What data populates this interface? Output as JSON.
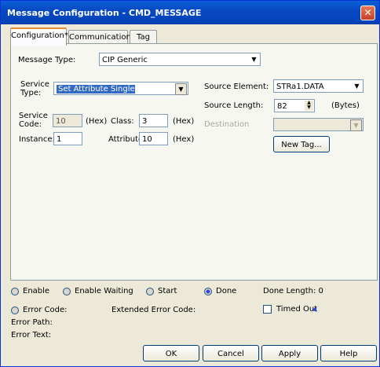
{
  "window": {
    "title": "Message Configuration - CMD_MESSAGE",
    "close_glyph": "✕"
  },
  "tabs": [
    {
      "label": "Configuration*"
    },
    {
      "label": "Communication"
    },
    {
      "label": "Tag"
    }
  ],
  "config": {
    "message_type_label": "Message Type:",
    "message_type_value": "CIP Generic",
    "service_type_label_1": "Service",
    "service_type_label_2": "Type:",
    "service_type_value": "Set Attribute Single",
    "service_code_label_1": "Service",
    "service_code_label_2": "Code:",
    "service_code_value": "10",
    "hex_label": "(Hex)",
    "class_label": "Class:",
    "class_value": "3",
    "instance_label": "Instance:",
    "instance_value": "1",
    "attribute_label": "Attribute:",
    "attribute_value": "10",
    "source_element_label": "Source Element:",
    "source_element_value": "STRa1.DATA",
    "source_length_label": "Source Length:",
    "source_length_value": "82",
    "bytes_label": "(Bytes)",
    "destination_label": "Destination",
    "new_tag_label": "New Tag..."
  },
  "status": {
    "enable": "Enable",
    "enable_waiting": "Enable Waiting",
    "start": "Start",
    "done": "Done",
    "done_length": "Done Length: 0",
    "error_code": "Error Code:",
    "extended_error_code": "Extended Error Code:",
    "timed_out": "Timed Out",
    "error_path": "Error Path:",
    "error_text": "Error Text:"
  },
  "buttons": {
    "ok": "OK",
    "cancel": "Cancel",
    "apply": "Apply",
    "help": "Help"
  }
}
